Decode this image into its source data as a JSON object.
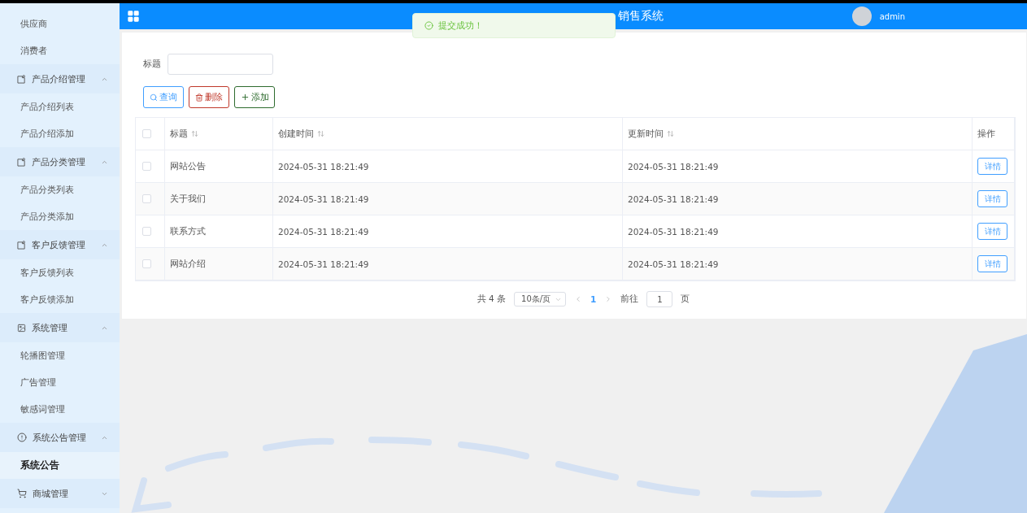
{
  "sidebar": {
    "items": [
      {
        "kind": "link",
        "label": "供应商",
        "selected": false
      },
      {
        "kind": "link",
        "label": "消费者",
        "selected": false
      },
      {
        "kind": "group",
        "label": "产品介绍管理",
        "expanded": true,
        "children": [
          {
            "label": "产品介绍列表",
            "selected": false
          },
          {
            "label": "产品介绍添加",
            "selected": false
          }
        ]
      },
      {
        "kind": "group",
        "label": "产品分类管理",
        "expanded": true,
        "children": [
          {
            "label": "产品分类列表",
            "selected": false
          },
          {
            "label": "产品分类添加",
            "selected": false
          }
        ]
      },
      {
        "kind": "group",
        "label": "客户反馈管理",
        "expanded": true,
        "children": [
          {
            "label": "客户反馈列表",
            "selected": false
          },
          {
            "label": "客户反馈添加",
            "selected": false
          }
        ]
      },
      {
        "kind": "group",
        "label": "系统管理",
        "expanded": true,
        "children": [
          {
            "label": "轮播图管理",
            "selected": false
          },
          {
            "label": "广告管理",
            "selected": false
          },
          {
            "label": "敏感词管理",
            "selected": false
          }
        ]
      },
      {
        "kind": "group",
        "label": "系统公告管理",
        "expanded": true,
        "children": [
          {
            "label": "系统公告",
            "selected": true
          }
        ]
      },
      {
        "kind": "group",
        "label": "商城管理",
        "expanded": false
      }
    ]
  },
  "header": {
    "title": "销售系统",
    "user": "admin"
  },
  "toast": {
    "message": "提交成功！"
  },
  "search": {
    "label": "标题"
  },
  "buttons": [
    {
      "kind": "search",
      "label": "查询"
    },
    {
      "kind": "delete",
      "label": "删除"
    },
    {
      "kind": "add",
      "label": "添加"
    }
  ],
  "table": {
    "all_checked": false,
    "columns": [
      {
        "label": "标题",
        "sortable": true
      },
      {
        "label": "创建时间",
        "sortable": true
      },
      {
        "label": "更新时间",
        "sortable": true
      },
      {
        "label": "操作",
        "sortable": false
      }
    ],
    "rows": [
      {
        "checked": false,
        "title": "网站公告",
        "created": "2024-05-31 18:21:49",
        "updated": "2024-05-31 18:21:49",
        "action": "详情"
      },
      {
        "checked": false,
        "title": "关于我们",
        "created": "2024-05-31 18:21:49",
        "updated": "2024-05-31 18:21:49",
        "action": "详情"
      },
      {
        "checked": false,
        "title": "联系方式",
        "created": "2024-05-31 18:21:49",
        "updated": "2024-05-31 18:21:49",
        "action": "详情"
      },
      {
        "checked": false,
        "title": "网站介绍",
        "created": "2024-05-31 18:21:49",
        "updated": "2024-05-31 18:21:49",
        "action": "详情"
      }
    ]
  },
  "pagination": {
    "total": "共 4 条",
    "page_size": "10条/页",
    "pages": [
      {
        "label": "1",
        "selected": true
      }
    ],
    "goto_label": "前往",
    "goto_value": "1",
    "goto_suffix": "页"
  }
}
